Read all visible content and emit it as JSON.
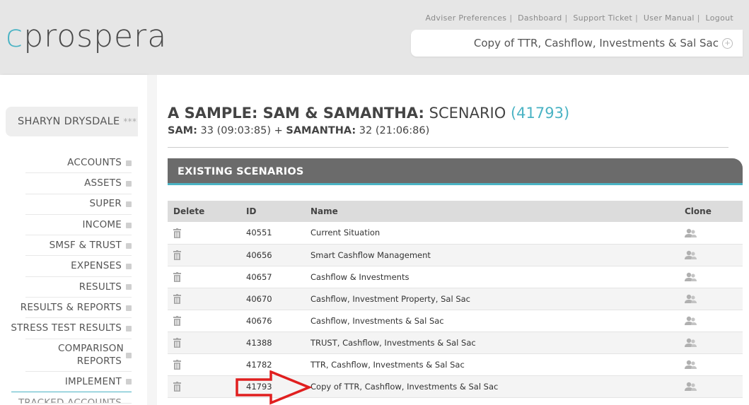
{
  "brand": {
    "logo_first": "c",
    "logo_rest": "prospera"
  },
  "top_links": [
    "Adviser Preferences",
    "Dashboard",
    "Support Ticket",
    "User Manual",
    "Logout"
  ],
  "current_scenario": "Copy of TTR, Cashflow, Investments & Sal Sac",
  "user": {
    "name": "SHARYN DRYSDALE",
    "stars": "***"
  },
  "nav": [
    "ACCOUNTS",
    "ASSETS",
    "SUPER",
    "INCOME",
    "SMSF & TRUST",
    "EXPENSES",
    "RESULTS",
    "RESULTS & REPORTS",
    "STRESS TEST RESULTS",
    "COMPARISON REPORTS",
    "IMPLEMENT",
    "TRACKED ACCOUNTS"
  ],
  "client": {
    "title_bold": "A SAMPLE: SAM & SAMANTHA:",
    "title_rest": "SCENARIO",
    "scenario_id": "(41793)",
    "p1_name": "SAM:",
    "p1_info": "33 (09:03:85)",
    "plus": "+",
    "p2_name": "SAMANTHA:",
    "p2_info": "32 (21:06:86)"
  },
  "section_title": "EXISTING SCENARIOS",
  "table": {
    "headers": {
      "delete": "Delete",
      "id": "ID",
      "name": "Name",
      "clone": "Clone"
    },
    "rows": [
      {
        "id": "40551",
        "name": "Current Situation"
      },
      {
        "id": "40656",
        "name": "Smart Cashflow Management"
      },
      {
        "id": "40657",
        "name": "Cashflow & Investments"
      },
      {
        "id": "40670",
        "name": "Cashflow, Investment Property, Sal Sac"
      },
      {
        "id": "40676",
        "name": "Cashflow, Investments & Sal Sac"
      },
      {
        "id": "41388",
        "name": "TRUST, Cashflow, Investments & Sal Sac"
      },
      {
        "id": "41782",
        "name": "TTR, Cashflow, Investments & Sal Sac"
      },
      {
        "id": "41793",
        "name": "Copy of TTR, Cashflow, Investments & Sal Sac"
      }
    ]
  },
  "colors": {
    "accent": "#4ab3c4",
    "section_bar": "#6b6b6b",
    "annotation": "#e01f1f"
  }
}
